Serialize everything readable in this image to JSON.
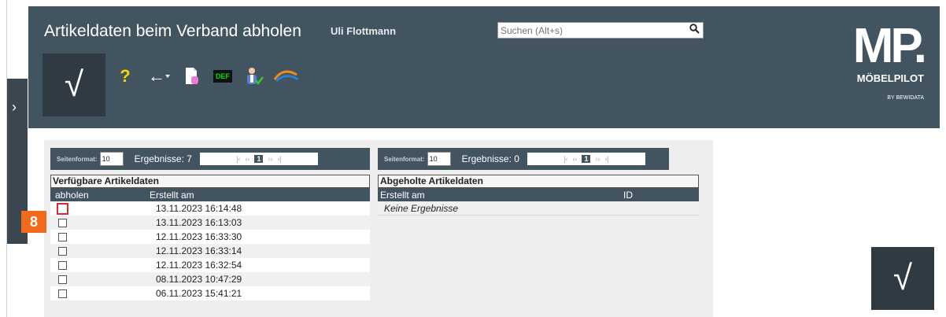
{
  "header": {
    "title": "Artikeldaten beim Verband abholen",
    "user": "Uli Flottmann",
    "search_placeholder": "Suchen (Alt+s)",
    "confirm_glyph": "√",
    "toolbar": {
      "help_glyph": "?",
      "back_glyph": "←",
      "def_label": "DEF"
    }
  },
  "brand": {
    "logo": "MP.",
    "name": "MÖBELPILOT",
    "sub": "BY BEWIDATA"
  },
  "left_panel": {
    "toggle_glyph": "›"
  },
  "available": {
    "pager": {
      "page_format_label": "Seitenformat:",
      "page_format_value": "10",
      "results": "Ergebnisse: 7",
      "first": "|‹",
      "prev": "‹‹",
      "current_page": "1",
      "next": "››",
      "last": "›|"
    },
    "title": "Verfügbare Artikeldaten",
    "columns": [
      "abholen",
      "Erstellt am"
    ],
    "rows": [
      "13.11.2023 16:14:48",
      "13.11.2023 16:13:03",
      "12.11.2023 16:33:30",
      "12.11.2023 16:33:14",
      "12.11.2023 16:32:54",
      "08.11.2023 10:47:29",
      "06.11.2023 15:41:21"
    ]
  },
  "fetched": {
    "pager": {
      "page_format_label": "Seitenformat:",
      "page_format_value": "10",
      "results": "Ergebnisse: 0",
      "first": "|‹",
      "prev": "‹‹",
      "current_page": "1",
      "next": "››",
      "last": "›|"
    },
    "title": "Abgeholte Artikeldaten",
    "columns": [
      "Erstellt am",
      "ID"
    ],
    "empty_text": "Keine Ergebnisse"
  },
  "step_badge": "8",
  "corner_confirm_glyph": "√"
}
